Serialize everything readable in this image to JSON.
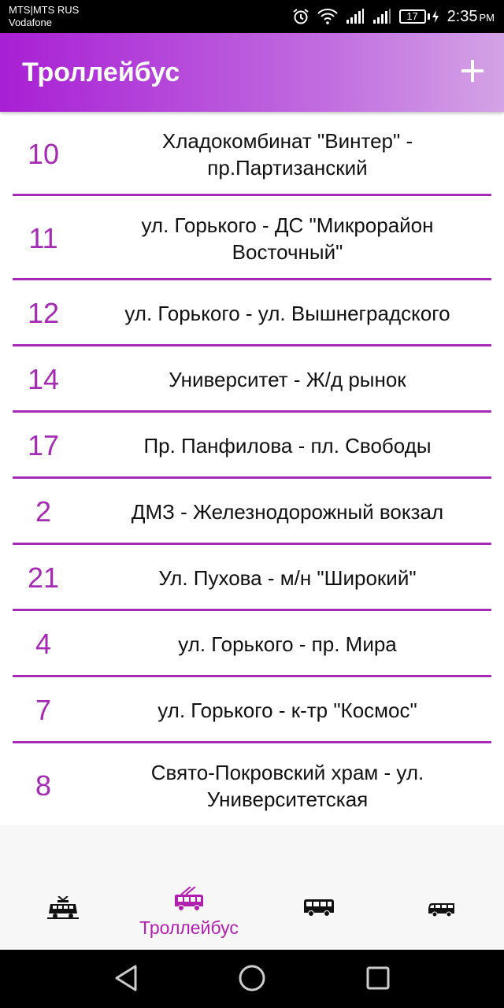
{
  "status_bar": {
    "carrier_line1": "MTS|MTS RUS",
    "carrier_line2": "Vodafone",
    "battery": "17",
    "time": "2:35",
    "ampm": "PM"
  },
  "header": {
    "title": "Троллейбус"
  },
  "routes": [
    {
      "number": "10",
      "name": "Хладокомбинат \"Винтер\" - пр.Партизанский"
    },
    {
      "number": "11",
      "name": "ул. Горького - ДС \"Микрорайон Восточный\""
    },
    {
      "number": "12",
      "name": "ул. Горького - ул. Вышнеградского"
    },
    {
      "number": "14",
      "name": "Университет - Ж/д рынок"
    },
    {
      "number": "17",
      "name": "Пр. Панфилова - пл. Свободы"
    },
    {
      "number": "2",
      "name": "ДМЗ - Железнодорожный вокзал"
    },
    {
      "number": "21",
      "name": "Ул. Пухова - м/н \"Широкий\""
    },
    {
      "number": "4",
      "name": "ул. Горького - пр. Мира"
    },
    {
      "number": "7",
      "name": "ул. Горького - к-тр \"Космос\""
    },
    {
      "number": "8",
      "name": "Свято-Покровский храм - ул. Университетская"
    }
  ],
  "bottom_nav": {
    "active_label": "Троллейбус",
    "items": [
      "tram-icon",
      "trolleybus-icon",
      "bus-icon",
      "minibus-icon"
    ]
  },
  "colors": {
    "accent": "#a52ab4",
    "nav_active": "#b21fb0",
    "app_bar_start": "#a81fd4",
    "app_bar_end": "#d4a3e6"
  }
}
